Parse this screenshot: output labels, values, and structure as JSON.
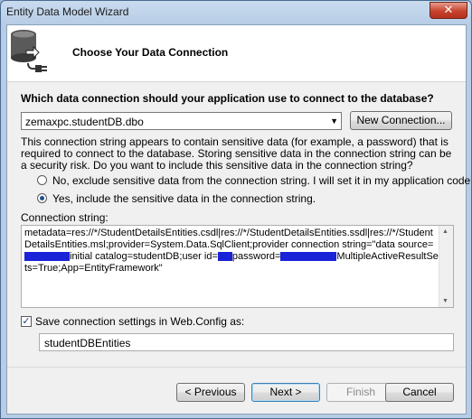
{
  "window": {
    "title": "Entity Data Model Wizard",
    "close_glyph": "✕"
  },
  "header": {
    "title": "Choose Your Data Connection",
    "icon": "database-plug-icon"
  },
  "question": "Which data connection should your application use to connect to the database?",
  "connection_select": {
    "value": "zemaxpc.studentDB.dbo"
  },
  "new_connection_button": "New Connection...",
  "sensitive_info": "This connection string appears to contain sensitive data (for example, a password) that is required to connect to the database. Storing sensitive data in the connection string can be a security risk. Do you want to include this sensitive data in the connection string?",
  "radios": [
    {
      "label": "No, exclude sensitive data from the connection string. I will set it in my application code.",
      "checked": false
    },
    {
      "label": "Yes, include the sensitive data in the connection string.",
      "checked": true
    }
  ],
  "connection_string": {
    "label": "Connection string:",
    "part1": "metadata=res://*/StudentDetailsEntities.csdl|res://*/StudentDetailsEntities.ssdl|res://*/StudentDetailsEntities.msl;provider=System.Data.SqlClient;provider connection string=\"data source=",
    "part2": "initial catalog=studentDB;user id=",
    "part3": "password=",
    "part4": "MultipleActiveResultSets=True;App=EntityFramework\""
  },
  "save_settings": {
    "checked": true,
    "label": "Save connection settings in Web.Config as:",
    "value": "studentDBEntities"
  },
  "footer": {
    "previous": "< Previous",
    "next": "Next >",
    "finish": "Finish",
    "cancel": "Cancel"
  },
  "colors": {
    "redaction": "#1a23d8",
    "title_gradient_top": "#c9dbef",
    "close_button": "#c6432e"
  }
}
